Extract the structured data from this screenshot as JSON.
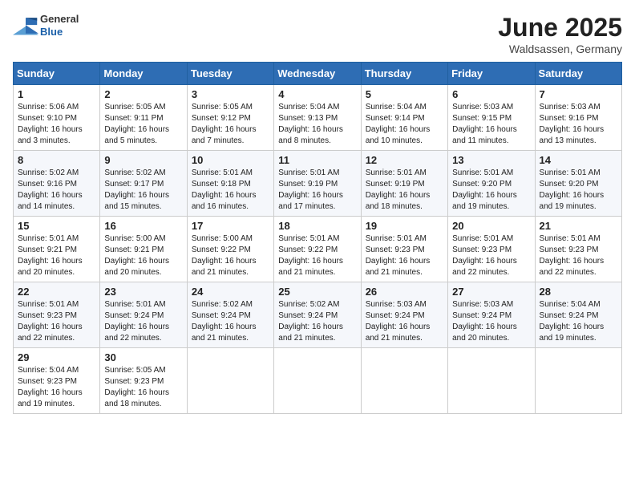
{
  "header": {
    "logo_general": "General",
    "logo_blue": "Blue",
    "month_title": "June 2025",
    "location": "Waldsassen, Germany"
  },
  "calendar": {
    "days_of_week": [
      "Sunday",
      "Monday",
      "Tuesday",
      "Wednesday",
      "Thursday",
      "Friday",
      "Saturday"
    ],
    "weeks": [
      [
        {
          "day": "1",
          "info": "Sunrise: 5:06 AM\nSunset: 9:10 PM\nDaylight: 16 hours\nand 3 minutes."
        },
        {
          "day": "2",
          "info": "Sunrise: 5:05 AM\nSunset: 9:11 PM\nDaylight: 16 hours\nand 5 minutes."
        },
        {
          "day": "3",
          "info": "Sunrise: 5:05 AM\nSunset: 9:12 PM\nDaylight: 16 hours\nand 7 minutes."
        },
        {
          "day": "4",
          "info": "Sunrise: 5:04 AM\nSunset: 9:13 PM\nDaylight: 16 hours\nand 8 minutes."
        },
        {
          "day": "5",
          "info": "Sunrise: 5:04 AM\nSunset: 9:14 PM\nDaylight: 16 hours\nand 10 minutes."
        },
        {
          "day": "6",
          "info": "Sunrise: 5:03 AM\nSunset: 9:15 PM\nDaylight: 16 hours\nand 11 minutes."
        },
        {
          "day": "7",
          "info": "Sunrise: 5:03 AM\nSunset: 9:16 PM\nDaylight: 16 hours\nand 13 minutes."
        }
      ],
      [
        {
          "day": "8",
          "info": "Sunrise: 5:02 AM\nSunset: 9:16 PM\nDaylight: 16 hours\nand 14 minutes."
        },
        {
          "day": "9",
          "info": "Sunrise: 5:02 AM\nSunset: 9:17 PM\nDaylight: 16 hours\nand 15 minutes."
        },
        {
          "day": "10",
          "info": "Sunrise: 5:01 AM\nSunset: 9:18 PM\nDaylight: 16 hours\nand 16 minutes."
        },
        {
          "day": "11",
          "info": "Sunrise: 5:01 AM\nSunset: 9:19 PM\nDaylight: 16 hours\nand 17 minutes."
        },
        {
          "day": "12",
          "info": "Sunrise: 5:01 AM\nSunset: 9:19 PM\nDaylight: 16 hours\nand 18 minutes."
        },
        {
          "day": "13",
          "info": "Sunrise: 5:01 AM\nSunset: 9:20 PM\nDaylight: 16 hours\nand 19 minutes."
        },
        {
          "day": "14",
          "info": "Sunrise: 5:01 AM\nSunset: 9:20 PM\nDaylight: 16 hours\nand 19 minutes."
        }
      ],
      [
        {
          "day": "15",
          "info": "Sunrise: 5:01 AM\nSunset: 9:21 PM\nDaylight: 16 hours\nand 20 minutes."
        },
        {
          "day": "16",
          "info": "Sunrise: 5:00 AM\nSunset: 9:21 PM\nDaylight: 16 hours\nand 20 minutes."
        },
        {
          "day": "17",
          "info": "Sunrise: 5:00 AM\nSunset: 9:22 PM\nDaylight: 16 hours\nand 21 minutes."
        },
        {
          "day": "18",
          "info": "Sunrise: 5:01 AM\nSunset: 9:22 PM\nDaylight: 16 hours\nand 21 minutes."
        },
        {
          "day": "19",
          "info": "Sunrise: 5:01 AM\nSunset: 9:23 PM\nDaylight: 16 hours\nand 21 minutes."
        },
        {
          "day": "20",
          "info": "Sunrise: 5:01 AM\nSunset: 9:23 PM\nDaylight: 16 hours\nand 22 minutes."
        },
        {
          "day": "21",
          "info": "Sunrise: 5:01 AM\nSunset: 9:23 PM\nDaylight: 16 hours\nand 22 minutes."
        }
      ],
      [
        {
          "day": "22",
          "info": "Sunrise: 5:01 AM\nSunset: 9:23 PM\nDaylight: 16 hours\nand 22 minutes."
        },
        {
          "day": "23",
          "info": "Sunrise: 5:01 AM\nSunset: 9:24 PM\nDaylight: 16 hours\nand 22 minutes."
        },
        {
          "day": "24",
          "info": "Sunrise: 5:02 AM\nSunset: 9:24 PM\nDaylight: 16 hours\nand 21 minutes."
        },
        {
          "day": "25",
          "info": "Sunrise: 5:02 AM\nSunset: 9:24 PM\nDaylight: 16 hours\nand 21 minutes."
        },
        {
          "day": "26",
          "info": "Sunrise: 5:03 AM\nSunset: 9:24 PM\nDaylight: 16 hours\nand 21 minutes."
        },
        {
          "day": "27",
          "info": "Sunrise: 5:03 AM\nSunset: 9:24 PM\nDaylight: 16 hours\nand 20 minutes."
        },
        {
          "day": "28",
          "info": "Sunrise: 5:04 AM\nSunset: 9:24 PM\nDaylight: 16 hours\nand 19 minutes."
        }
      ],
      [
        {
          "day": "29",
          "info": "Sunrise: 5:04 AM\nSunset: 9:23 PM\nDaylight: 16 hours\nand 19 minutes."
        },
        {
          "day": "30",
          "info": "Sunrise: 5:05 AM\nSunset: 9:23 PM\nDaylight: 16 hours\nand 18 minutes."
        },
        {
          "day": "",
          "info": ""
        },
        {
          "day": "",
          "info": ""
        },
        {
          "day": "",
          "info": ""
        },
        {
          "day": "",
          "info": ""
        },
        {
          "day": "",
          "info": ""
        }
      ]
    ]
  }
}
